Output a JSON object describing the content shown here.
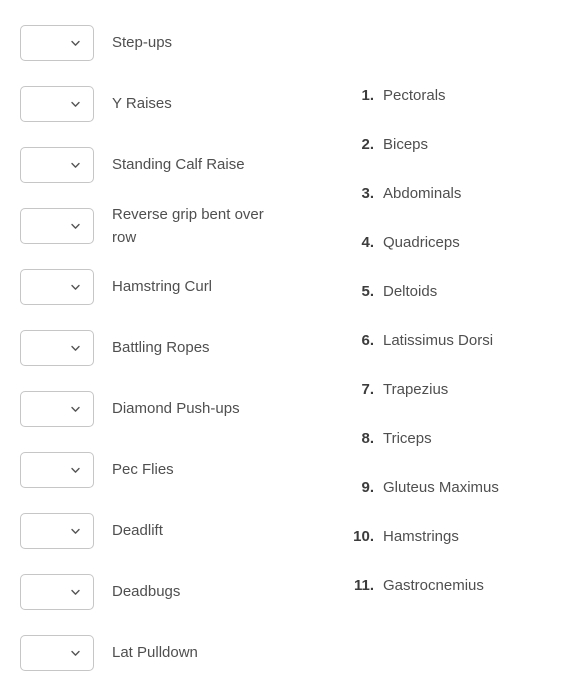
{
  "colors": {
    "background": "#ffffff",
    "text": "#4f4f4f",
    "number_text": "#3c3c3c",
    "border": "#c6c6c6",
    "chevron": "#555555"
  },
  "exercise_list": {
    "select_placeholder": "",
    "select_value": "",
    "chevron_icon": "chevron-down-icon",
    "items": [
      {
        "label": "Step-ups",
        "value": ""
      },
      {
        "label": "Y Raises",
        "value": ""
      },
      {
        "label": "Standing Calf Raise",
        "value": ""
      },
      {
        "label": "Reverse grip bent over row",
        "value": ""
      },
      {
        "label": "Hamstring Curl",
        "value": ""
      },
      {
        "label": "Battling Ropes",
        "value": ""
      },
      {
        "label": "Diamond Push-ups",
        "value": ""
      },
      {
        "label": "Pec Flies",
        "value": ""
      },
      {
        "label": "Deadlift",
        "value": ""
      },
      {
        "label": "Deadbugs",
        "value": ""
      },
      {
        "label": "Lat Pulldown",
        "value": ""
      }
    ]
  },
  "muscle_list": {
    "items": [
      {
        "number": "1.",
        "label": "Pectorals"
      },
      {
        "number": "2.",
        "label": "Biceps"
      },
      {
        "number": "3.",
        "label": "Abdominals"
      },
      {
        "number": "4.",
        "label": "Quadriceps"
      },
      {
        "number": "5.",
        "label": "Deltoids"
      },
      {
        "number": "6.",
        "label": "Latissimus Dorsi"
      },
      {
        "number": "7.",
        "label": "Trapezius"
      },
      {
        "number": "8.",
        "label": "Triceps"
      },
      {
        "number": "9.",
        "label": "Gluteus Maximus"
      },
      {
        "number": "10.",
        "label": "Hamstrings"
      },
      {
        "number": "11.",
        "label": "Gastrocnemius"
      }
    ]
  }
}
